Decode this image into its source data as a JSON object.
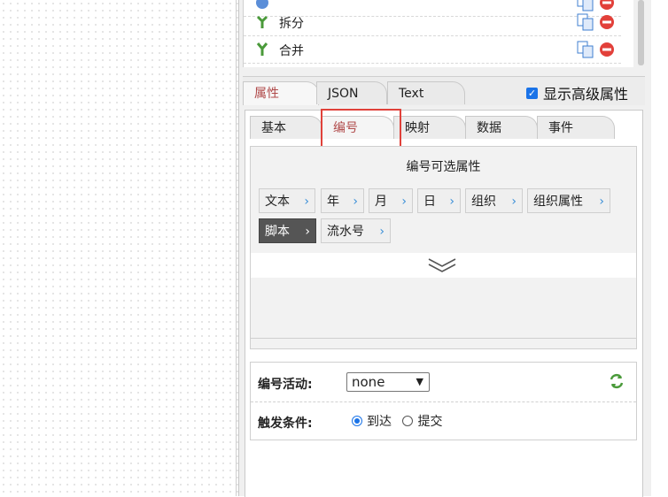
{
  "node_list": [
    {
      "label": "拆分",
      "icon": "split-icon"
    },
    {
      "label": "合并",
      "icon": "merge-icon"
    }
  ],
  "top_tabs": [
    "属性",
    "JSON",
    "Text"
  ],
  "advanced": {
    "label": "显示高级属性",
    "checked": true
  },
  "sub_tabs": [
    "基本",
    "编号",
    "映射",
    "数据",
    "事件"
  ],
  "segment": {
    "title": "编号可选属性",
    "chips": [
      {
        "label": "文本"
      },
      {
        "label": "年"
      },
      {
        "label": "月"
      },
      {
        "label": "日"
      },
      {
        "label": "组织"
      },
      {
        "label": "组织属性"
      },
      {
        "label": "脚本"
      },
      {
        "label": "流水号"
      }
    ]
  },
  "form": {
    "activity_label": "编号活动:",
    "activity_value": "none",
    "trigger_label": "触发条件:",
    "trigger_options": [
      {
        "label": "到达",
        "selected": true
      },
      {
        "label": "提交",
        "selected": false
      }
    ]
  },
  "colors": {
    "active_tab": "#b04a4a",
    "highlight": "#e0413a",
    "chip_arrow": "#3a8fd8",
    "delete": "#e2403a"
  }
}
